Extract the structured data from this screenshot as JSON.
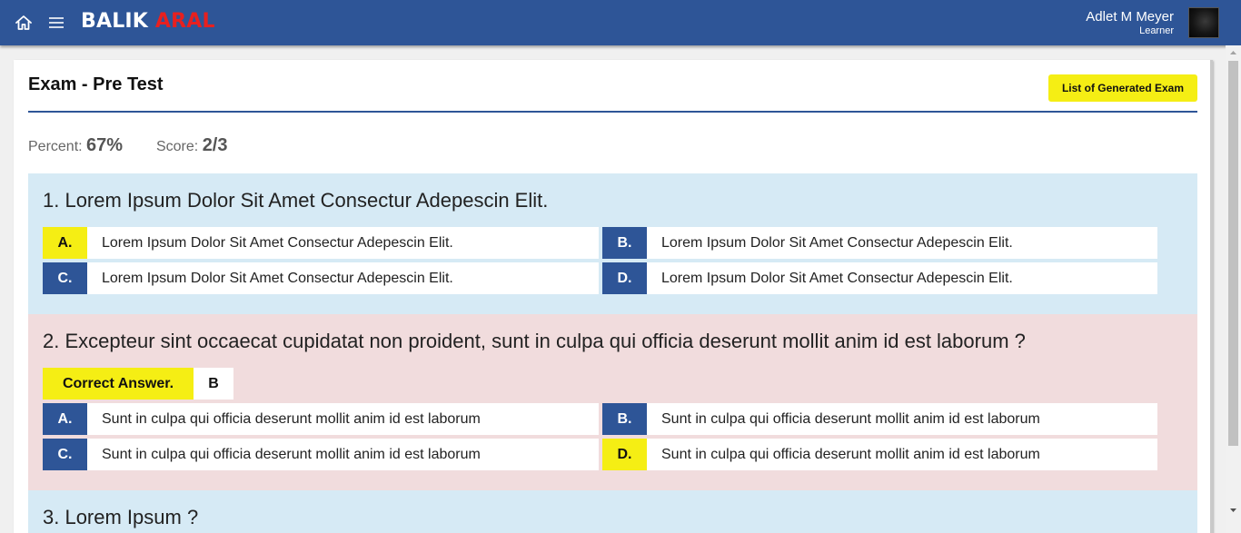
{
  "header": {
    "brand_part1": "BALIK",
    "brand_part2": "ARAL",
    "user_name": "Adlet M Meyer",
    "user_role": "Learner",
    "icons": [
      "home-icon",
      "menu-icon"
    ],
    "colors": {
      "bar": "#2e5597",
      "brand_accent": "#e8201f"
    }
  },
  "page": {
    "title": "Exam - Pre Test",
    "list_button": "List of Generated Exam",
    "percent_label": "Percent:",
    "percent_value": "67%",
    "score_label": "Score:",
    "score_value": "2/3"
  },
  "questions": [
    {
      "text": "1. Lorem Ipsum Dolor Sit Amet Consectur Adepescin Elit.",
      "status_color": "#d6eaf5",
      "options": [
        {
          "letter": "A.",
          "text": "Lorem Ipsum Dolor Sit Amet Consectur Adepescin Elit.",
          "selected": true
        },
        {
          "letter": "B.",
          "text": "Lorem Ipsum Dolor Sit Amet Consectur Adepescin Elit.",
          "selected": false
        },
        {
          "letter": "C.",
          "text": "Lorem Ipsum Dolor Sit Amet Consectur Adepescin Elit.",
          "selected": false
        },
        {
          "letter": "D.",
          "text": "Lorem Ipsum Dolor Sit Amet Consectur Adepescin Elit.",
          "selected": false
        }
      ]
    },
    {
      "text": "2. Excepteur sint occaecat cupidatat non proident, sunt in culpa qui officia deserunt mollit anim id est laborum ?",
      "status_color": "#f1dcdd",
      "correct_label": "Correct Answer.",
      "correct_value": "B",
      "options": [
        {
          "letter": "A.",
          "text": "Sunt in culpa qui officia deserunt mollit anim id est laborum",
          "selected": false
        },
        {
          "letter": "B.",
          "text": "Sunt in culpa qui officia deserunt mollit anim id est laborum",
          "selected": false
        },
        {
          "letter": "C.",
          "text": "Sunt in culpa qui officia deserunt mollit anim id est laborum",
          "selected": false
        },
        {
          "letter": "D.",
          "text": "Sunt in culpa qui officia deserunt mollit anim id est laborum",
          "selected": true
        }
      ]
    },
    {
      "text": "3. Lorem Ipsum ?",
      "status_color": "#d6eaf5"
    }
  ]
}
